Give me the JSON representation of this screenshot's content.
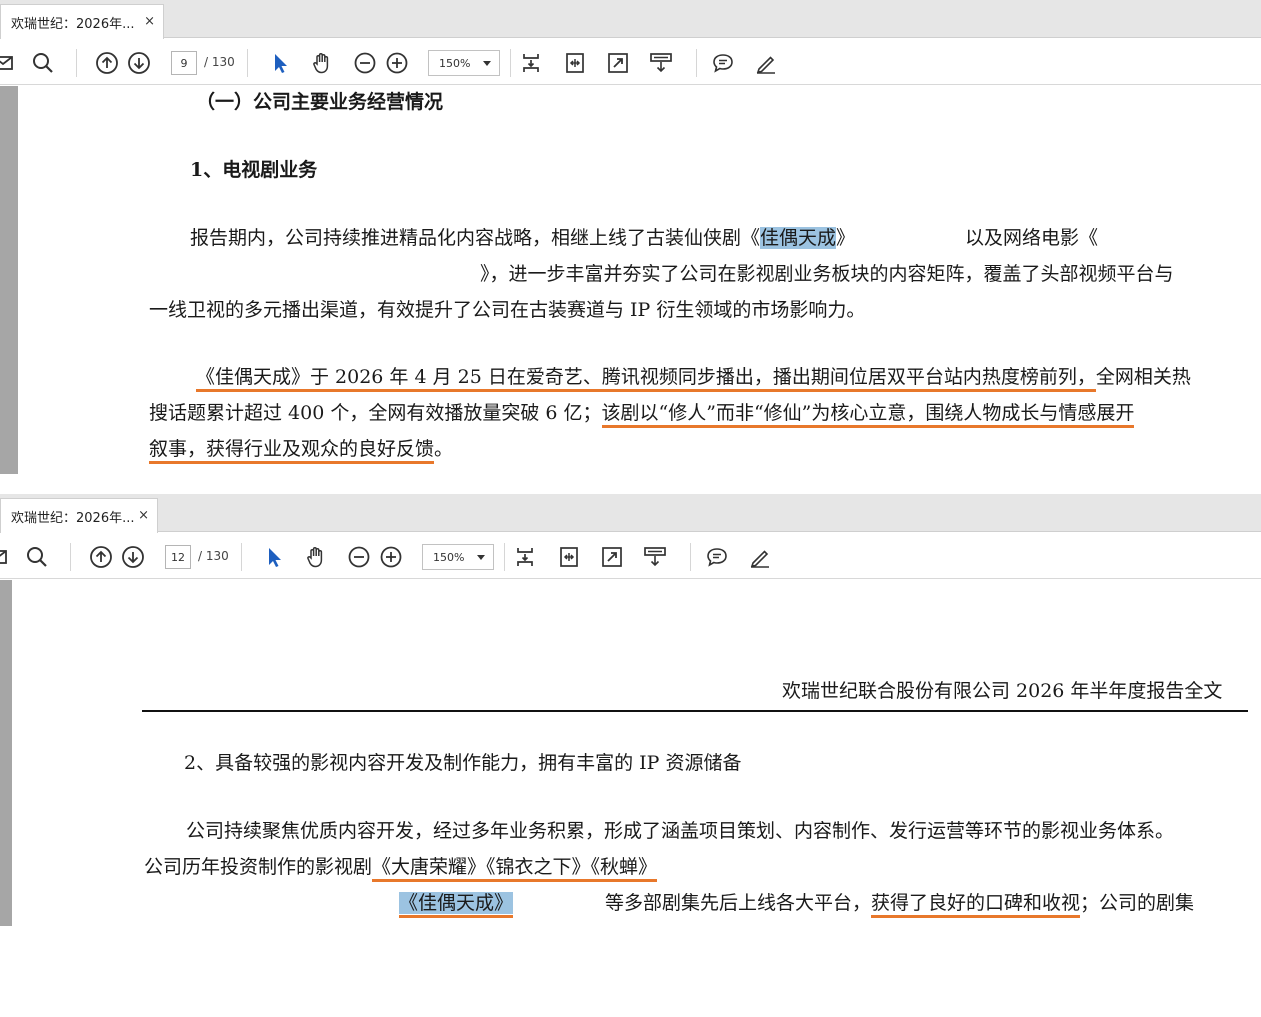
{
  "pane1": {
    "tab": {
      "title": "欢瑞世纪：2026年...",
      "close": "×"
    },
    "toolbar": {
      "page_current": "9",
      "page_total": "/ 130",
      "zoom": "150%"
    },
    "lines": {
      "l1": "（一）公司主要业务经营情况",
      "l2": "1、电视剧业务",
      "l3a": "报告期内，公司持续推进精品化内容战略，相继上线了古装仙侠剧《",
      "l3hl": "佳偶天成",
      "l3b": "》",
      "l3c": "以及网络电影《",
      "l4": "》，进一步丰富并夯实了公司在影视剧业务板块的内容矩阵，覆盖了头部视频平台与",
      "l5": "一线卫视的多元播出渠道，有效提升了公司在古装赛道与 IP 衍生领域的市场影响力。",
      "l6u": "《佳偶天成》于 2026 年 4 月 25 日在爱奇艺、腾讯视频同步播出，播出期间位居双平台站内热度榜前列，",
      "l6b": "全网相关热",
      "l7a": "搜话题累计超过 400 个，全网有效播放量突破 6 亿；",
      "l7u": "该剧以“修人”而非“修仙”为核心立意，围绕人物成长与情感展开",
      "l8u": "叙事，获得行业及观众的良好反馈",
      "l8b": "。"
    }
  },
  "pane2": {
    "tab": {
      "title": "欢瑞世纪：2026年...",
      "close": "×"
    },
    "toolbar": {
      "page_current": "12",
      "page_total": "/ 130",
      "zoom": "150%"
    },
    "lines": {
      "header": "欢瑞世纪联合股份有限公司 2026 年半年度报告全文",
      "h2": "2、具备较强的影视内容开发及制作能力，拥有丰富的 IP 资源储备",
      "p1": "公司持续聚焦优质内容开发，经过多年业务积累，形成了涵盖项目策划、内容制作、发行运营等环节的影视业务体系。",
      "p2a": "公司历年投资制作的影视剧",
      "p2u": "《大唐荣耀》《锦衣之下》《秋蝉》",
      "p3hl": "《佳偶天成》",
      "p3a": "等多部剧集先后上线各大平台，",
      "p3u": "获得了良好的口碑和收视",
      "p3b": "；公司的剧集"
    }
  },
  "colors": {
    "highlight": "#9cc3e1",
    "underline": "#e8782b",
    "gutter": "#a6a6a6"
  }
}
